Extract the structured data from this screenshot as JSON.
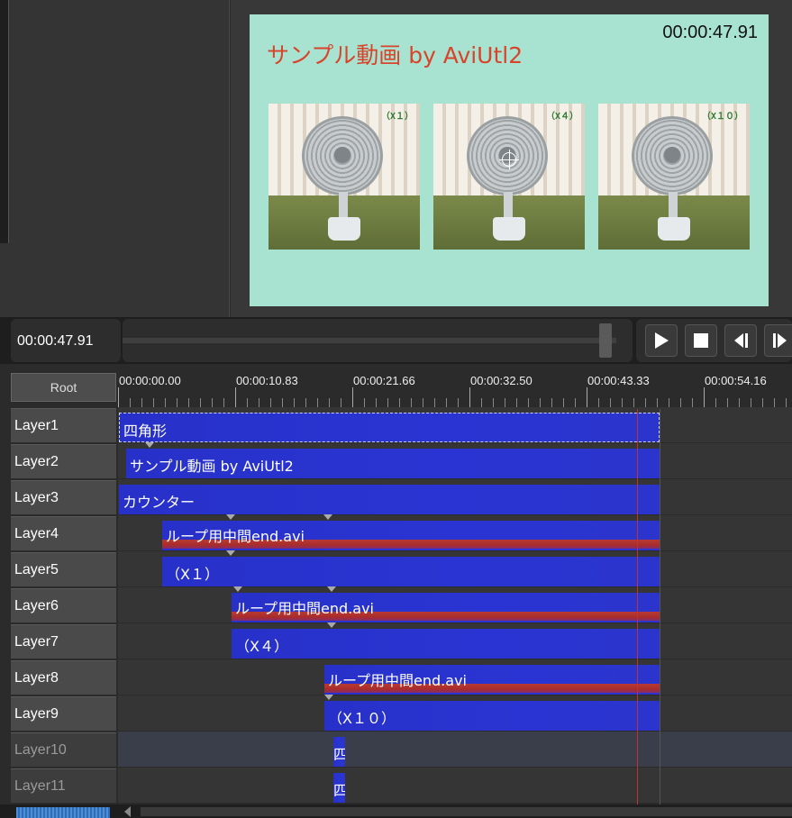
{
  "preview": {
    "title": "サンプル動画 by AviUtl2",
    "counter": "00:00:47.91",
    "thumbnails": [
      {
        "label": "（X１）"
      },
      {
        "label": "（X４）"
      },
      {
        "label": "（X１０）"
      }
    ]
  },
  "transport": {
    "current_time": "00:00:47.91",
    "seek_position": 0.98,
    "buttons": {
      "play": "play-icon",
      "stop": "stop-icon",
      "step_back": "step-back-icon",
      "step_forward": "step-forward-icon"
    }
  },
  "timeline": {
    "root_label": "Root",
    "ruler": [
      "00:00:00.00",
      "00:00:10.83",
      "00:00:21.66",
      "00:00:32.50",
      "00:00:43.33",
      "00:00:54.16"
    ],
    "layers": [
      {
        "name": "Layer1",
        "clip": "四角形"
      },
      {
        "name": "Layer2",
        "clip": "サンプル動画 by AviUtl2"
      },
      {
        "name": "Layer3",
        "clip": "カウンター"
      },
      {
        "name": "Layer4",
        "clip": "ループ用中間end.avi"
      },
      {
        "name": "Layer5",
        "clip": "（X１）"
      },
      {
        "name": "Layer6",
        "clip": "ループ用中間end.avi"
      },
      {
        "name": "Layer7",
        "clip": "（X４）"
      },
      {
        "name": "Layer8",
        "clip": "ループ用中間end.avi"
      },
      {
        "name": "Layer9",
        "clip": "（X１０）"
      },
      {
        "name": "Layer10",
        "clip": "四"
      },
      {
        "name": "Layer11",
        "clip": "四"
      }
    ]
  },
  "colors": {
    "clip_blue": "#2a34d2",
    "audio_red": "#c0392b",
    "preview_bg": "#a8e3d2",
    "title_red": "#d8432a"
  }
}
